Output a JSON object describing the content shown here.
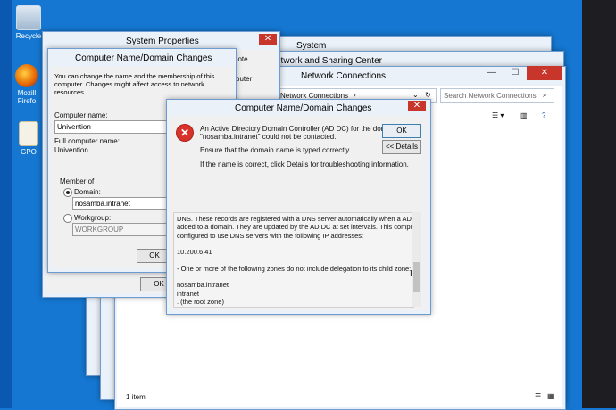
{
  "desktop": {
    "icons": [
      {
        "label": "Recycle",
        "name": "recycle-bin"
      },
      {
        "label": "Mozill\nFirefo",
        "name": "firefox"
      },
      {
        "label": "GPO",
        "name": "gpo"
      }
    ]
  },
  "system_props": {
    "title": "System Properties",
    "tab_fragment": "note",
    "ok": "OK",
    "close": "✕",
    "puter_fragment": "puter"
  },
  "cnd_back": {
    "title": "Computer Name/Domain Changes",
    "intro": "You can change the name and the membership of this computer. Changes might affect access to network resources.",
    "computer_name_label": "Computer name:",
    "computer_name_value": "Univention",
    "full_name_label": "Full computer name:",
    "full_name_value": "Univention",
    "member_of": "Member of",
    "domain_label": "Domain:",
    "domain_value": "nosamba.intranet",
    "workgroup_label": "Workgroup:",
    "workgroup_value": "WORKGROUP",
    "ok": "OK",
    "close": "✕"
  },
  "system_win": {
    "title": "System"
  },
  "nsc_win": {
    "title": "etwork and Sharing Center"
  },
  "netconn": {
    "title": "Network Connections",
    "path": "Network Connections",
    "search_placeholder": "Search Network Connections",
    "status": "1 item",
    "minimize": "—",
    "maximize": "☐",
    "close": "✕"
  },
  "error_dialog": {
    "title": "Computer Name/Domain Changes",
    "line1": "An Active Directory Domain Controller (AD DC) for the domain",
    "line2": "\"nosamba.intranet\" could not be contacted.",
    "line3": "Ensure that the domain name is typed correctly.",
    "line4": "If the name is correct, click Details for troubleshooting information.",
    "ok": "OK",
    "details": "<< Details",
    "close": "✕",
    "details_lines": [
      "DNS. These records are registered with a DNS server automatically when a AD DC is",
      "added to a domain. They are updated by the AD DC at set intervals. This computer is",
      "configured to use DNS servers with the following IP addresses:",
      "",
      "10.200.6.41",
      "",
      "- One or more of the following zones do not include delegation to its child zone:",
      "",
      "nosamba.intranet",
      "intranet",
      ". (the root zone)"
    ]
  }
}
